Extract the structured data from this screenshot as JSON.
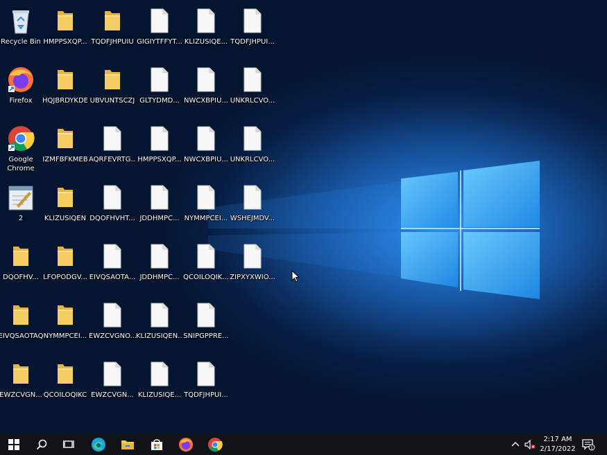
{
  "desktop": {
    "icons": [
      {
        "label": "Recycle Bin",
        "type": "recycle"
      },
      {
        "label": "Firefox",
        "type": "firefox"
      },
      {
        "label": "Google Chrome",
        "type": "chrome"
      },
      {
        "label": "2",
        "type": "notepad"
      },
      {
        "label": "DQOFHV...",
        "type": "folder"
      },
      {
        "label": "EIVQSAOTAQ",
        "type": "folder"
      },
      {
        "label": "EWZCVGN...",
        "type": "folder"
      },
      {
        "label": "HMPPSXQP...",
        "type": "folder"
      },
      {
        "label": "HQJBRDYKDE",
        "type": "folder"
      },
      {
        "label": "IZMFBFKMEB",
        "type": "folder"
      },
      {
        "label": "KLIZUSIQEN",
        "type": "folder"
      },
      {
        "label": "LFOPODGV...",
        "type": "folder"
      },
      {
        "label": "NYMMPCEI...",
        "type": "folder"
      },
      {
        "label": "QCOILOQIKC",
        "type": "folder"
      },
      {
        "label": "TQDFJHPUIU",
        "type": "folder"
      },
      {
        "label": "UBVUNTSCZJ",
        "type": "folder"
      },
      {
        "label": "AQRFEVRTG...",
        "type": "file"
      },
      {
        "label": "DQOFHVHT...",
        "type": "file"
      },
      {
        "label": "EIVQSAOTA...",
        "type": "file"
      },
      {
        "label": "EWZCVGNO...",
        "type": "file"
      },
      {
        "label": "EWZCVGN...",
        "type": "file"
      },
      {
        "label": "GIGIYTFFYT...",
        "type": "file"
      },
      {
        "label": "GLTYDMD...",
        "type": "file"
      },
      {
        "label": "HMPPSXQP...",
        "type": "file"
      },
      {
        "label": "JDDHMPC...",
        "type": "file"
      },
      {
        "label": "JDDHMPC...",
        "type": "file"
      },
      {
        "label": "KLIZUSIQEN...",
        "type": "file"
      },
      {
        "label": "KLIZUSIQE...",
        "type": "file"
      },
      {
        "label": "KLIZUSIQE...",
        "type": "file"
      },
      {
        "label": "NWCXBPIU...",
        "type": "file"
      },
      {
        "label": "NWCXBPIU...",
        "type": "file"
      },
      {
        "label": "NYMMPCEI...",
        "type": "file"
      },
      {
        "label": "QCOILOQIK...",
        "type": "file"
      },
      {
        "label": "SNIPGPPRE...",
        "type": "file"
      },
      {
        "label": "TQDFJHPUI...",
        "type": "file"
      },
      {
        "label": "TQDFJHPUI...",
        "type": "file"
      },
      {
        "label": "UNKRLCVO...",
        "type": "file"
      },
      {
        "label": "UNKRLCVO...",
        "type": "file"
      },
      {
        "label": "WSHEJMDV...",
        "type": "file"
      },
      {
        "label": "ZIPXYXWIO...",
        "type": "file"
      }
    ]
  },
  "taskbar": {
    "items": [
      {
        "name": "start-button",
        "icon": "windows-logo-icon"
      },
      {
        "name": "search-button",
        "icon": "search-icon"
      },
      {
        "name": "task-view-button",
        "icon": "task-view-icon"
      },
      {
        "name": "edge-button",
        "icon": "edge-icon"
      },
      {
        "name": "file-explorer-button",
        "icon": "folder-icon"
      },
      {
        "name": "store-button",
        "icon": "store-icon"
      },
      {
        "name": "firefox-button",
        "icon": "firefox-icon"
      },
      {
        "name": "chrome-button",
        "icon": "chrome-icon"
      }
    ],
    "clock": {
      "time": "2:17 AM",
      "date": "2/17/2022"
    },
    "notification_count": "1"
  },
  "colors": {
    "taskbar": "#101418",
    "folder": "#f4c95d",
    "file": "#f5f5f5",
    "accent": "#4fb3ff"
  }
}
